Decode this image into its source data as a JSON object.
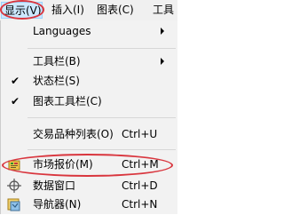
{
  "menubar": {
    "items": [
      {
        "label": "显示(V)"
      },
      {
        "label": "插入(I)"
      },
      {
        "label": "图表(C)"
      },
      {
        "label": "工具"
      }
    ]
  },
  "menu": {
    "items": [
      {
        "label": "Languages"
      },
      {
        "label": "工具栏(B)"
      },
      {
        "label": "状态栏(S)",
        "check": "✔"
      },
      {
        "label": "图表工具栏(C)",
        "check": "✔"
      },
      {
        "label": "交易品种列表(O)",
        "shortcut": "Ctrl+U"
      },
      {
        "label": "市场报价(M)",
        "shortcut": "Ctrl+M"
      },
      {
        "label": "数据窗口",
        "shortcut": "Ctrl+D"
      },
      {
        "label": "导航器(N)",
        "shortcut": "Ctrl+N"
      }
    ]
  },
  "colors": {
    "highlight_ring": "#d9363e",
    "active_menu_bg": "#cce8ff",
    "menu_bg": "#f2f2f2"
  }
}
